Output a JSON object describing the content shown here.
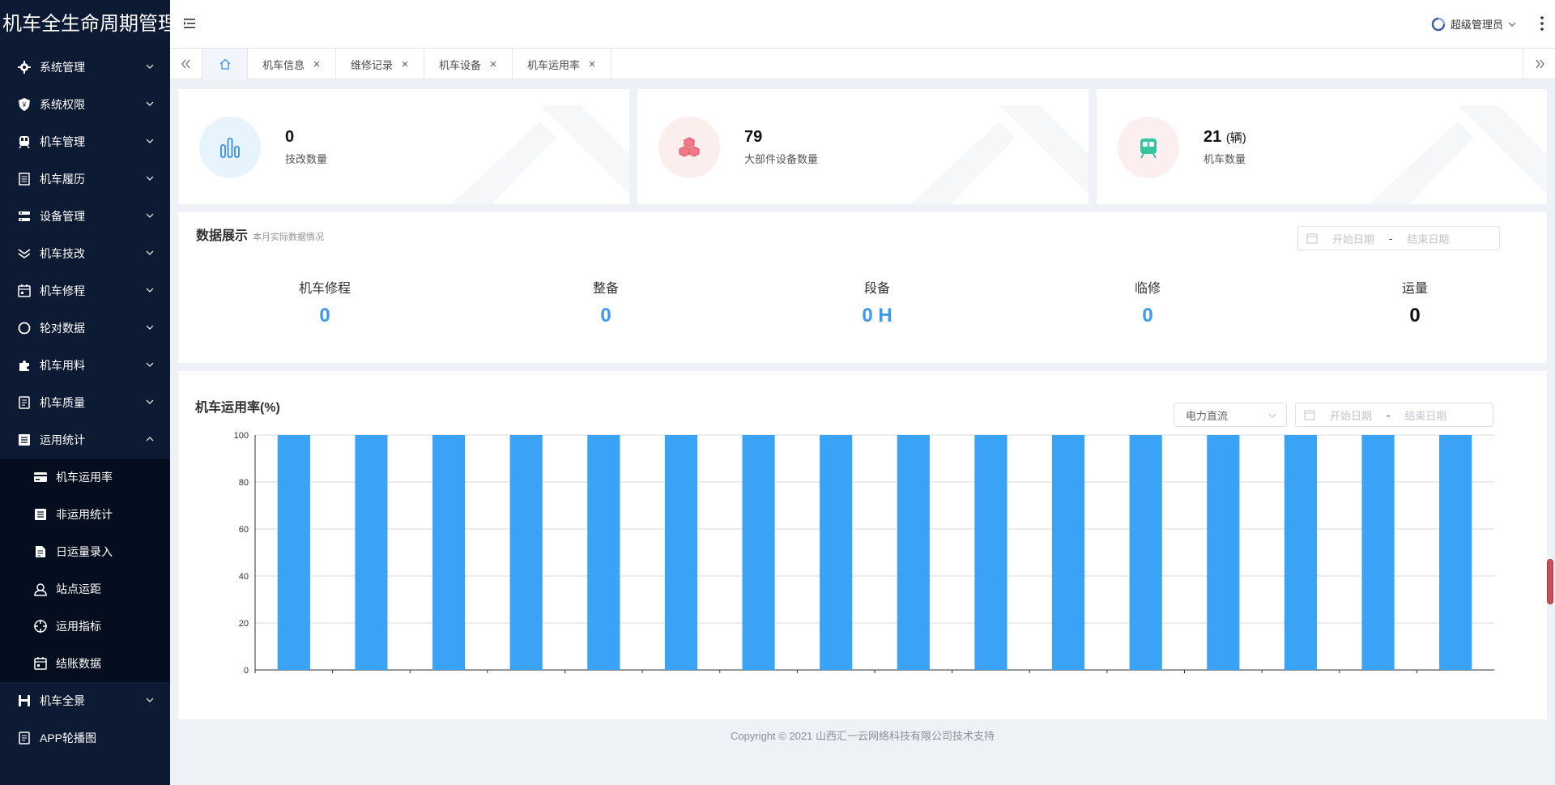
{
  "app": {
    "title": "机车全生命周期管理"
  },
  "sidebar": {
    "items": [
      {
        "label": "系统管理",
        "icon": "gear-icon"
      },
      {
        "label": "系统权限",
        "icon": "shield-icon"
      },
      {
        "label": "机车管理",
        "icon": "train-icon"
      },
      {
        "label": "机车履历",
        "icon": "document-icon"
      },
      {
        "label": "设备管理",
        "icon": "server-icon"
      },
      {
        "label": "机车技改",
        "icon": "double-chevron-icon"
      },
      {
        "label": "机车修程",
        "icon": "calendar-icon"
      },
      {
        "label": "轮对数据",
        "icon": "circle-icon"
      },
      {
        "label": "机车用料",
        "icon": "puzzle-icon"
      },
      {
        "label": "机车质量",
        "icon": "clipboard-icon"
      },
      {
        "label": "运用统计",
        "icon": "list-icon"
      }
    ],
    "submenu": [
      {
        "label": "机车运用率",
        "icon": "card-icon"
      },
      {
        "label": "非运用统计",
        "icon": "list-icon"
      },
      {
        "label": "日运量录入",
        "icon": "edit-document-icon"
      },
      {
        "label": "站点运距",
        "icon": "user-pin-icon"
      },
      {
        "label": "运用指标",
        "icon": "target-icon"
      },
      {
        "label": "结账数据",
        "icon": "calendar-icon"
      }
    ],
    "bottom_items": [
      {
        "label": "机车全景",
        "icon": "save-icon"
      },
      {
        "label": "APP轮播图",
        "icon": "clipboard-icon"
      }
    ]
  },
  "header": {
    "user": "超级管理员"
  },
  "tabs": [
    {
      "label": "机车信息"
    },
    {
      "label": "维修记录"
    },
    {
      "label": "机车设备"
    },
    {
      "label": "机车运用率"
    }
  ],
  "stats": [
    {
      "value": "0",
      "unit": "",
      "label": "技改数量"
    },
    {
      "value": "79",
      "unit": "",
      "label": "大部件设备数量"
    },
    {
      "value": "21",
      "unit": "(辆)",
      "label": "机车数量"
    }
  ],
  "data_display": {
    "title": "数据展示",
    "subtitle": "本月实际数据情况",
    "start_placeholder": "开始日期",
    "end_placeholder": "结束日期",
    "separator": "-",
    "metrics": [
      {
        "label": "机车修程",
        "value": "0"
      },
      {
        "label": "整备",
        "value": "0"
      },
      {
        "label": "段备",
        "value": "0 H"
      },
      {
        "label": "临修",
        "value": "0"
      },
      {
        "label": "运量",
        "value": "0"
      }
    ]
  },
  "usage_chart": {
    "select_value": "电力直流",
    "start_placeholder": "开始日期",
    "end_placeholder": "结束日期",
    "separator": "-"
  },
  "chart_data": {
    "type": "bar",
    "title": "机车运用率(%)",
    "categories": [
      "",
      "",
      "",
      "",
      "",
      "",
      "",
      "",
      "",
      "",
      "",
      "",
      "",
      "",
      "",
      ""
    ],
    "values": [
      100,
      100,
      100,
      100,
      100,
      100,
      100,
      100,
      100,
      100,
      100,
      100,
      100,
      100,
      100,
      100
    ],
    "ylim": [
      0,
      100
    ],
    "yticks": [
      0,
      20,
      40,
      60,
      80,
      100
    ],
    "grid": true,
    "color": "#3aa3f5"
  },
  "footer": {
    "text": "Copyright © 2021 山西汇一云网络科技有限公司技术支持"
  }
}
